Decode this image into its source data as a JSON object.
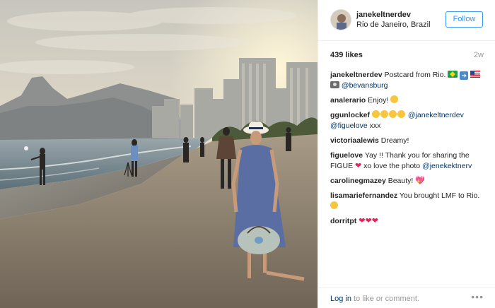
{
  "post": {
    "username": "janekeltnerdev",
    "location": "Rio de Janeiro, Brazil",
    "follow_label": "Follow",
    "likes": "439 likes",
    "age": "2w",
    "caption": {
      "user": "janekeltnerdev",
      "text_a": "Postcard from Rio.",
      "mention": "@bevansburg"
    },
    "comments": [
      {
        "user": "analerario",
        "text": "Enjoy!"
      },
      {
        "user": "ggunlockef",
        "mention": "@janekeltnerdev",
        "mention2": "@figuelove",
        "text": "xxx"
      },
      {
        "user": "victoriaalewis",
        "text": "Dreamy!"
      },
      {
        "user": "figuelove",
        "text_a": "Yay !! Thank you for sharing the FIGUE",
        "text_b": "xo love the photo",
        "mention": "@jenekektnerv"
      },
      {
        "user": "carolinegmazey",
        "text": "Beauty!"
      },
      {
        "user": "lisamariefernandez",
        "text": "You brought LMF to Rio."
      },
      {
        "user": "dorritpt",
        "text": ""
      }
    ],
    "footer": {
      "login_link": "Log in",
      "login_text": "to like or comment.",
      "more": "•••"
    }
  },
  "icons": {
    "avatar": "avatar",
    "brazil_flag": "brazil-flag-icon",
    "arrow": "arrow-right-icon",
    "us_flag": "us-flag-icon",
    "camera": "camera-icon",
    "kiss_face": "kiss-face-icon",
    "heart": "heart-icon",
    "sparkle_heart": "sparkling-heart-icon",
    "smile": "smile-icon",
    "more": "more-options-icon"
  }
}
